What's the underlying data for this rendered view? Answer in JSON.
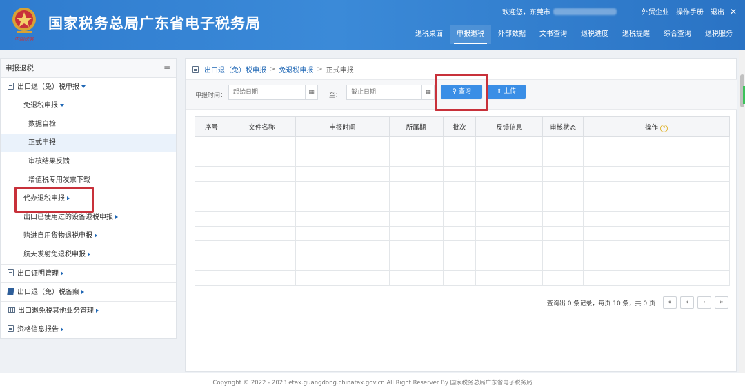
{
  "header": {
    "site_title": "国家税务总局广东省电子税务局",
    "logo_caption": "中国税务",
    "welcome": "欢迎您，东莞市",
    "links": [
      "外贸企业",
      "操作手册",
      "退出"
    ],
    "nav": [
      {
        "label": "退税桌面",
        "active": false
      },
      {
        "label": "申报退税",
        "active": true
      },
      {
        "label": "外部数据",
        "active": false
      },
      {
        "label": "文书查询",
        "active": false
      },
      {
        "label": "退税进度",
        "active": false
      },
      {
        "label": "退税提醒",
        "active": false
      },
      {
        "label": "综合查询",
        "active": false
      },
      {
        "label": "退税服务",
        "active": false
      }
    ]
  },
  "sidebar": {
    "title": "申报退税",
    "items": [
      {
        "label": "出口退（免）税申报",
        "level": 1,
        "icon": "doc-icon",
        "arrow": "down"
      },
      {
        "label": "免退税申报",
        "level": 2,
        "arrow": "down"
      },
      {
        "label": "数据自检",
        "level": 3
      },
      {
        "label": "正式申报",
        "level": 3,
        "active": true
      },
      {
        "label": "审核结果反馈",
        "level": 3
      },
      {
        "label": "增值税专用发票下载",
        "level": 3
      },
      {
        "label": "代办退税申报",
        "level": 2,
        "arrow": "right"
      },
      {
        "label": "出口已使用过的设备退税申报",
        "level": 2,
        "arrow": "right"
      },
      {
        "label": "购进自用货物退税申报",
        "level": 2,
        "arrow": "right"
      },
      {
        "label": "航天发射免退税申报",
        "level": 2,
        "arrow": "right"
      },
      {
        "label": "出口证明管理",
        "level": 1,
        "icon": "doc-icon",
        "arrow": "right",
        "sep": true
      },
      {
        "label": "出口退（免）税备案",
        "level": 1,
        "icon": "book-icon",
        "arrow": "right",
        "sep": true
      },
      {
        "label": "出口退免税其他业务管理",
        "level": 1,
        "icon": "card-icon",
        "arrow": "right",
        "sep": true
      },
      {
        "label": "资格信息报告",
        "level": 1,
        "icon": "doc-icon",
        "arrow": "right",
        "sep": true
      }
    ]
  },
  "breadcrumb": {
    "items": [
      "出口退（免）税申报",
      "免退税申报",
      "正式申报"
    ],
    "separator": ">"
  },
  "filter": {
    "date_label": "申报时间：",
    "start_placeholder": "起始日期",
    "to_label": "至：",
    "end_placeholder": "截止日期",
    "query_label": "查询",
    "upload_label": "上传"
  },
  "table": {
    "columns": [
      "序号",
      "文件名称",
      "申报时间",
      "所属期",
      "批次",
      "反馈信息",
      "审核状态",
      "操作"
    ],
    "rows": []
  },
  "pager": {
    "info": "查询出 0 条记录，每页 10 条，共 0 页",
    "buttons": [
      "«",
      "‹",
      "›",
      "»"
    ]
  },
  "footer": {
    "copyright": "Copyright © 2022 - 2023 etax.guangdong.chinatax.gov.cn All Right Reserver By 国家税务总局广东省电子税务局"
  },
  "colors": {
    "header_blue": "#2f7ccf",
    "primary_button": "#3a8ee6",
    "highlight_red": "#c8313a",
    "link_blue": "#1f67b5"
  }
}
